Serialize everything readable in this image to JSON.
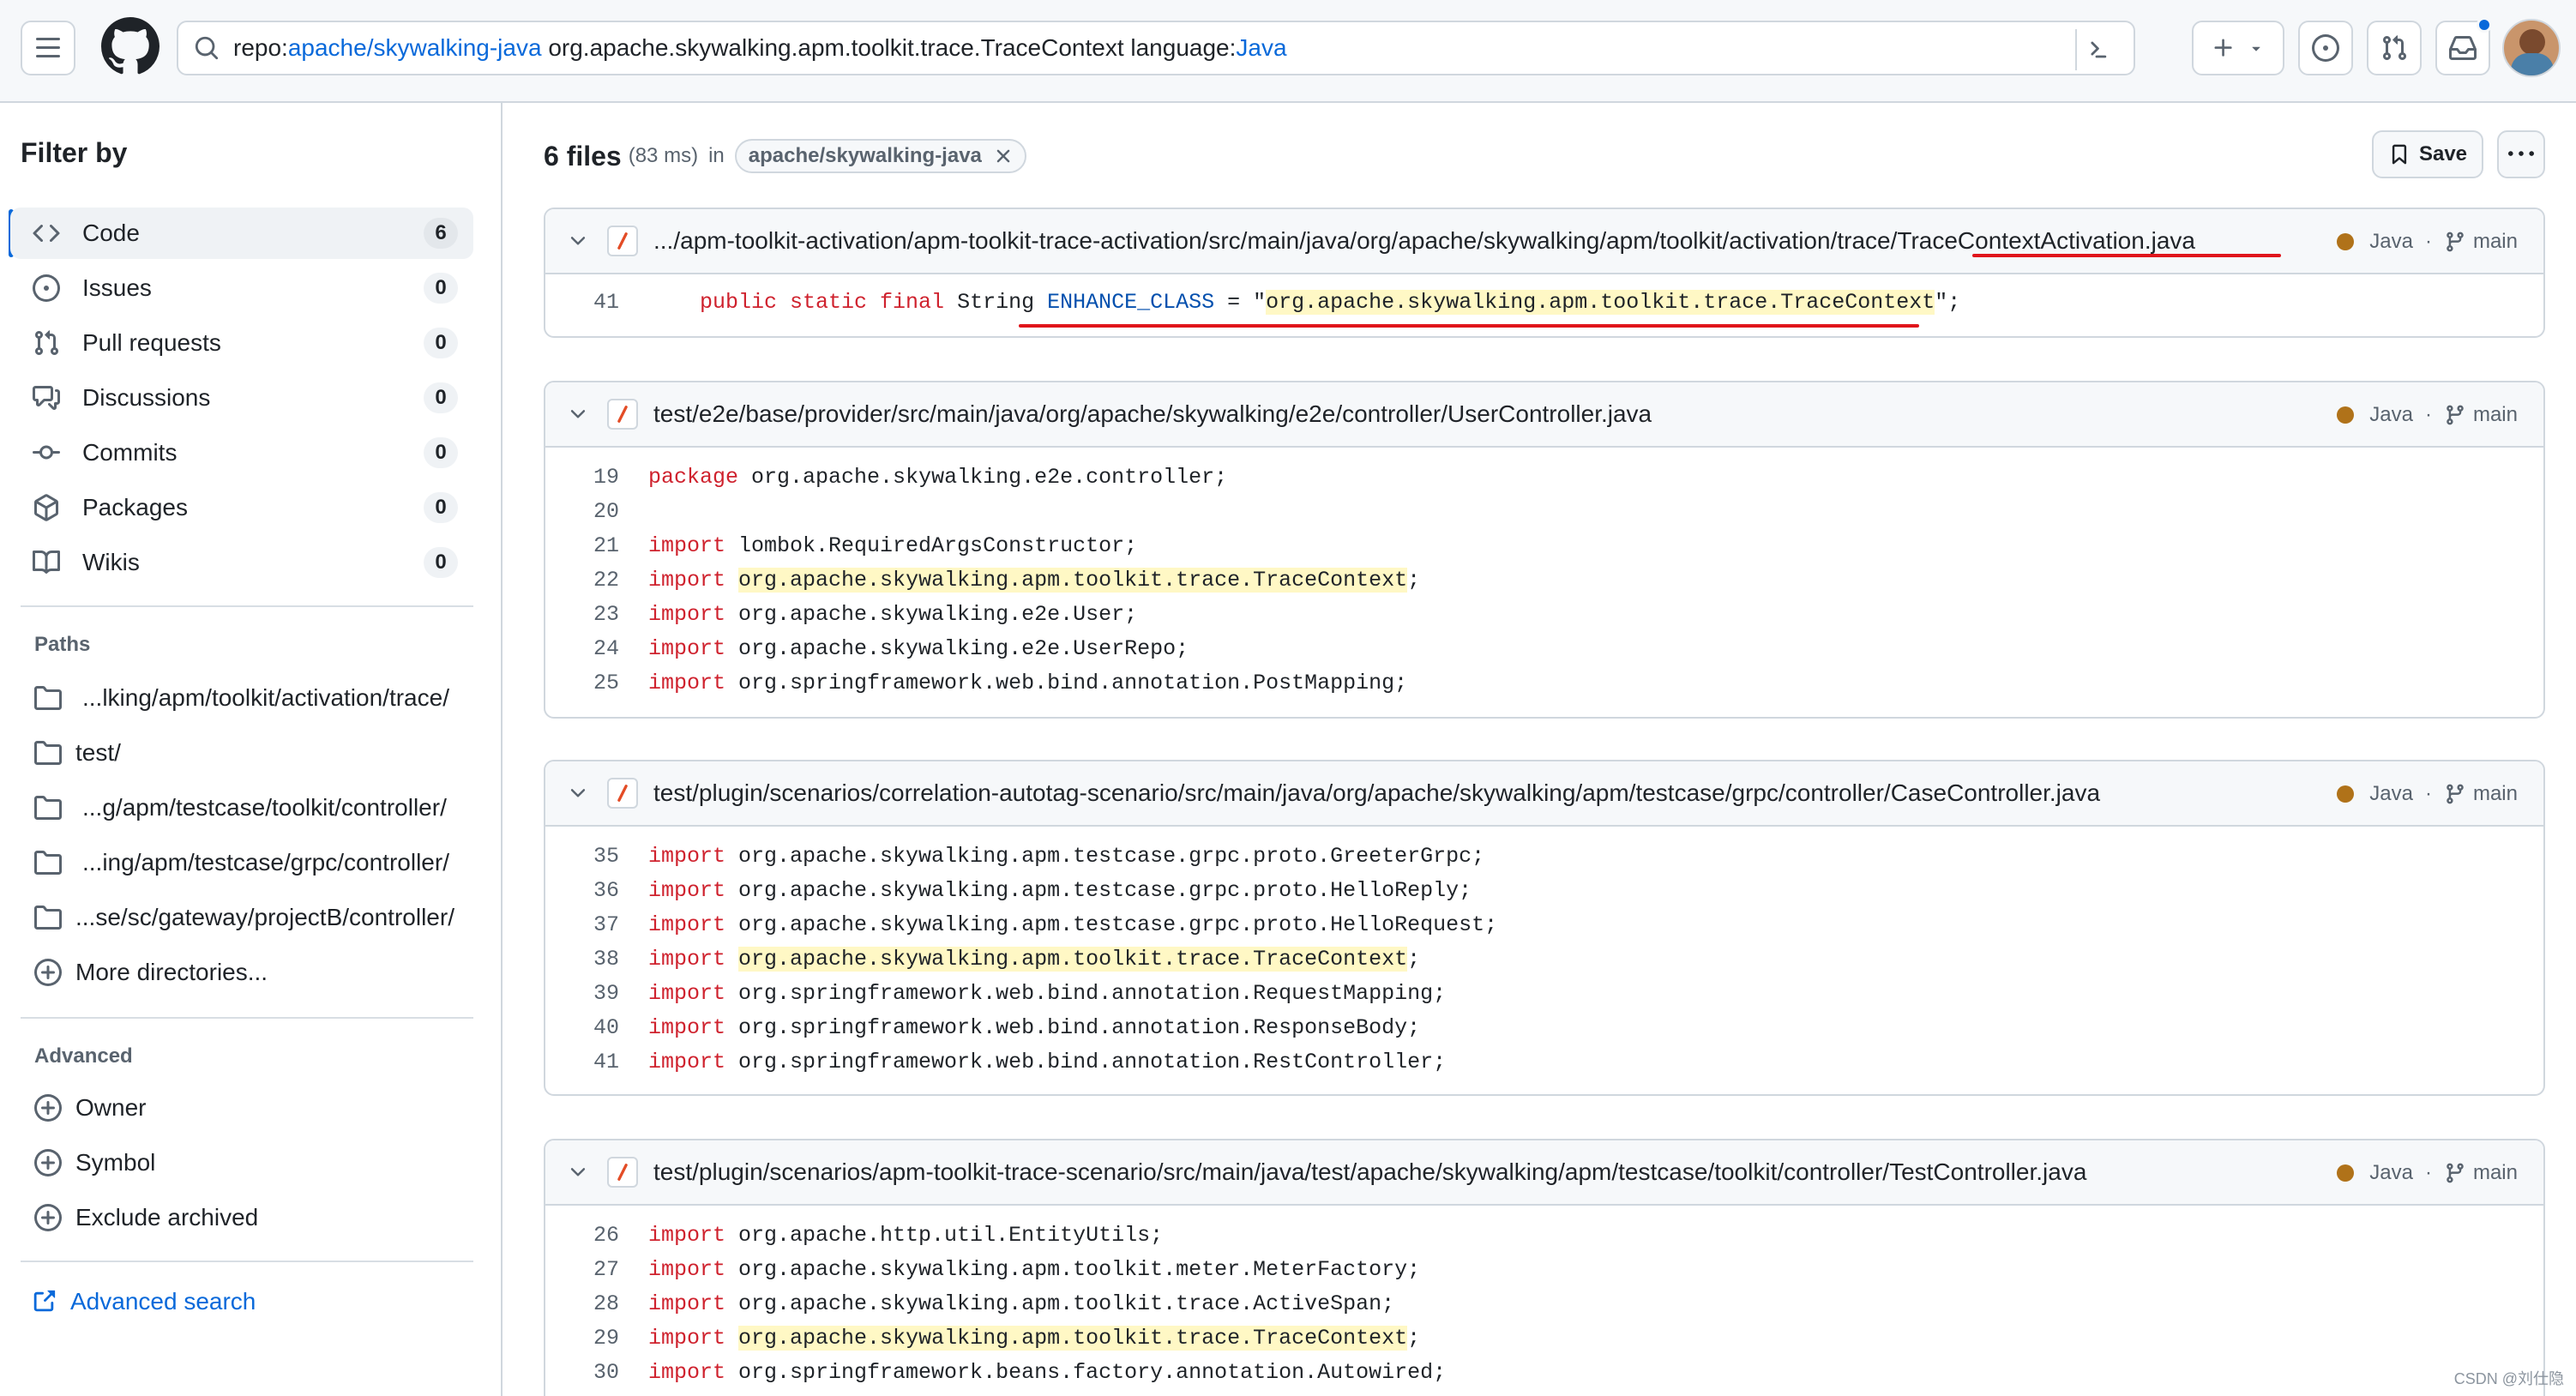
{
  "header": {
    "menu_icon": "hamburger-icon",
    "logo_icon": "github-logo",
    "search": {
      "prefix_repo_key": "repo:",
      "prefix_repo_value": "apache/skywalking-java",
      "query_text": " org.apache.skywalking.apm.toolkit.trace.TraceContext ",
      "lang_key": "language:",
      "lang_value": "Java"
    }
  },
  "sidebar": {
    "title": "Filter by",
    "types": [
      {
        "label": "Code",
        "count": "6",
        "icon": "code-icon"
      },
      {
        "label": "Issues",
        "count": "0",
        "icon": "issue-icon"
      },
      {
        "label": "Pull requests",
        "count": "0",
        "icon": "pull-request-icon"
      },
      {
        "label": "Discussions",
        "count": "0",
        "icon": "discussion-icon"
      },
      {
        "label": "Commits",
        "count": "0",
        "icon": "commit-icon"
      },
      {
        "label": "Packages",
        "count": "0",
        "icon": "package-icon"
      },
      {
        "label": "Wikis",
        "count": "0",
        "icon": "book-icon"
      }
    ],
    "paths_title": "Paths",
    "paths": [
      "...lking/apm/toolkit/activation/trace/",
      "test/",
      "...g/apm/testcase/toolkit/controller/",
      "...ing/apm/testcase/grpc/controller/",
      "...se/sc/gateway/projectB/controller/"
    ],
    "more_dirs": "More directories...",
    "advanced_title": "Advanced",
    "advanced": [
      "Owner",
      "Symbol",
      "Exclude archived"
    ],
    "advanced_search": "Advanced search"
  },
  "results": {
    "count_label": "6 files",
    "time": "(83 ms)",
    "in_label": "in",
    "repo_chip": "apache/skywalking-java",
    "save_label": "Save"
  },
  "files": [
    {
      "path_prefix": ".../apm-toolkit-activation/apm-toolkit-trace-activation/src/main/java/org/apache/skywalking/apm/toolkit/activation/trace/",
      "path_file": "TraceContextActivation.java",
      "language": "Java",
      "branch": "main",
      "lines": [
        {
          "n": "41",
          "pre": "    ",
          "kw": "public static final",
          "t1": " String ",
          "en": "ENHANCE_CLASS",
          "t2": " = \"",
          "hl": "org.apache.skywalking.apm.toolkit.trace.TraceContext",
          "t3": "\";"
        }
      ]
    },
    {
      "path": "test/e2e/base/provider/src/main/java/org/apache/skywalking/e2e/controller/UserController.java",
      "language": "Java",
      "branch": "main",
      "lines": [
        {
          "n": "19",
          "kw": "package",
          "t1": " org.apache.skywalking.e2e.controller;",
          "hl": "",
          "t3": ""
        },
        {
          "n": "20",
          "kw": "",
          "t1": "",
          "hl": "",
          "t3": ""
        },
        {
          "n": "21",
          "kw": "import",
          "t1": " lombok.RequiredArgsConstructor;",
          "hl": "",
          "t3": ""
        },
        {
          "n": "22",
          "kw": "import",
          "t1": " ",
          "hl": "org.apache.skywalking.apm.toolkit.trace.TraceContext",
          "t3": ";"
        },
        {
          "n": "23",
          "kw": "import",
          "t1": " org.apache.skywalking.e2e.User;",
          "hl": "",
          "t3": ""
        },
        {
          "n": "24",
          "kw": "import",
          "t1": " org.apache.skywalking.e2e.UserRepo;",
          "hl": "",
          "t3": ""
        },
        {
          "n": "25",
          "kw": "import",
          "t1": " org.springframework.web.bind.annotation.PostMapping;",
          "hl": "",
          "t3": ""
        }
      ]
    },
    {
      "path": "test/plugin/scenarios/correlation-autotag-scenario/src/main/java/org/apache/skywalking/apm/testcase/grpc/controller/CaseController.java",
      "language": "Java",
      "branch": "main",
      "lines": [
        {
          "n": "35",
          "kw": "import",
          "t1": " org.apache.skywalking.apm.testcase.grpc.proto.GreeterGrpc;",
          "hl": "",
          "t3": ""
        },
        {
          "n": "36",
          "kw": "import",
          "t1": " org.apache.skywalking.apm.testcase.grpc.proto.HelloReply;",
          "hl": "",
          "t3": ""
        },
        {
          "n": "37",
          "kw": "import",
          "t1": " org.apache.skywalking.apm.testcase.grpc.proto.HelloRequest;",
          "hl": "",
          "t3": ""
        },
        {
          "n": "38",
          "kw": "import",
          "t1": " ",
          "hl": "org.apache.skywalking.apm.toolkit.trace.TraceContext",
          "t3": ";"
        },
        {
          "n": "39",
          "kw": "import",
          "t1": " org.springframework.web.bind.annotation.RequestMapping;",
          "hl": "",
          "t3": ""
        },
        {
          "n": "40",
          "kw": "import",
          "t1": " org.springframework.web.bind.annotation.ResponseBody;",
          "hl": "",
          "t3": ""
        },
        {
          "n": "41",
          "kw": "import",
          "t1": " org.springframework.web.bind.annotation.RestController;",
          "hl": "",
          "t3": ""
        }
      ]
    },
    {
      "path": "test/plugin/scenarios/apm-toolkit-trace-scenario/src/main/java/test/apache/skywalking/apm/testcase/toolkit/controller/TestController.java",
      "language": "Java",
      "branch": "main",
      "lines": [
        {
          "n": "26",
          "kw": "import",
          "t1": " org.apache.http.util.EntityUtils;",
          "hl": "",
          "t3": ""
        },
        {
          "n": "27",
          "kw": "import",
          "t1": " org.apache.skywalking.apm.toolkit.meter.MeterFactory;",
          "hl": "",
          "t3": ""
        },
        {
          "n": "28",
          "kw": "import",
          "t1": " org.apache.skywalking.apm.toolkit.trace.ActiveSpan;",
          "hl": "",
          "t3": ""
        },
        {
          "n": "29",
          "kw": "import",
          "t1": " ",
          "hl": "org.apache.skywalking.apm.toolkit.trace.TraceContext",
          "t3": ";"
        },
        {
          "n": "30",
          "kw": "import",
          "t1": " org.springframework.beans.factory.annotation.Autowired;",
          "hl": "",
          "t3": ""
        }
      ]
    }
  ],
  "watermark": "CSDN @刘仕隐"
}
